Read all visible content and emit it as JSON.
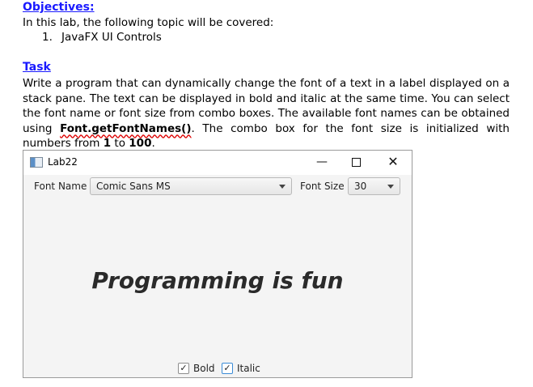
{
  "doc": {
    "objectives_heading": "Objectives:",
    "intro": "In this lab, the following topic will be covered:",
    "list": [
      {
        "num": "1.",
        "text": "JavaFX UI Controls"
      }
    ],
    "task_heading": "Task",
    "task_part1": "Write a program that can dynamically change the font of a text in a label displayed on a stack pane. The text can be displayed in bold and italic at the same time. You can select the font name or font size from combo boxes. The available font names can be obtained using ",
    "task_code": "Font.getFontNames()",
    "task_part2": ". The combo box for the font size is initialized with numbers from ",
    "range_from": "1",
    "range_to_word": " to ",
    "range_to": "100",
    "task_end": "."
  },
  "window": {
    "title": "Lab22",
    "min_glyph": "—",
    "close_glyph": "✕"
  },
  "toolbar": {
    "font_name_label": "Font Name",
    "font_name_value": "Comic Sans MS",
    "font_size_label": "Font Size",
    "font_size_value": "30"
  },
  "stage": {
    "text": "Programming is fun"
  },
  "checks": {
    "bold_label": "Bold",
    "bold_checked": true,
    "italic_label": "Italic",
    "italic_checked": true,
    "check_glyph": "✓"
  }
}
